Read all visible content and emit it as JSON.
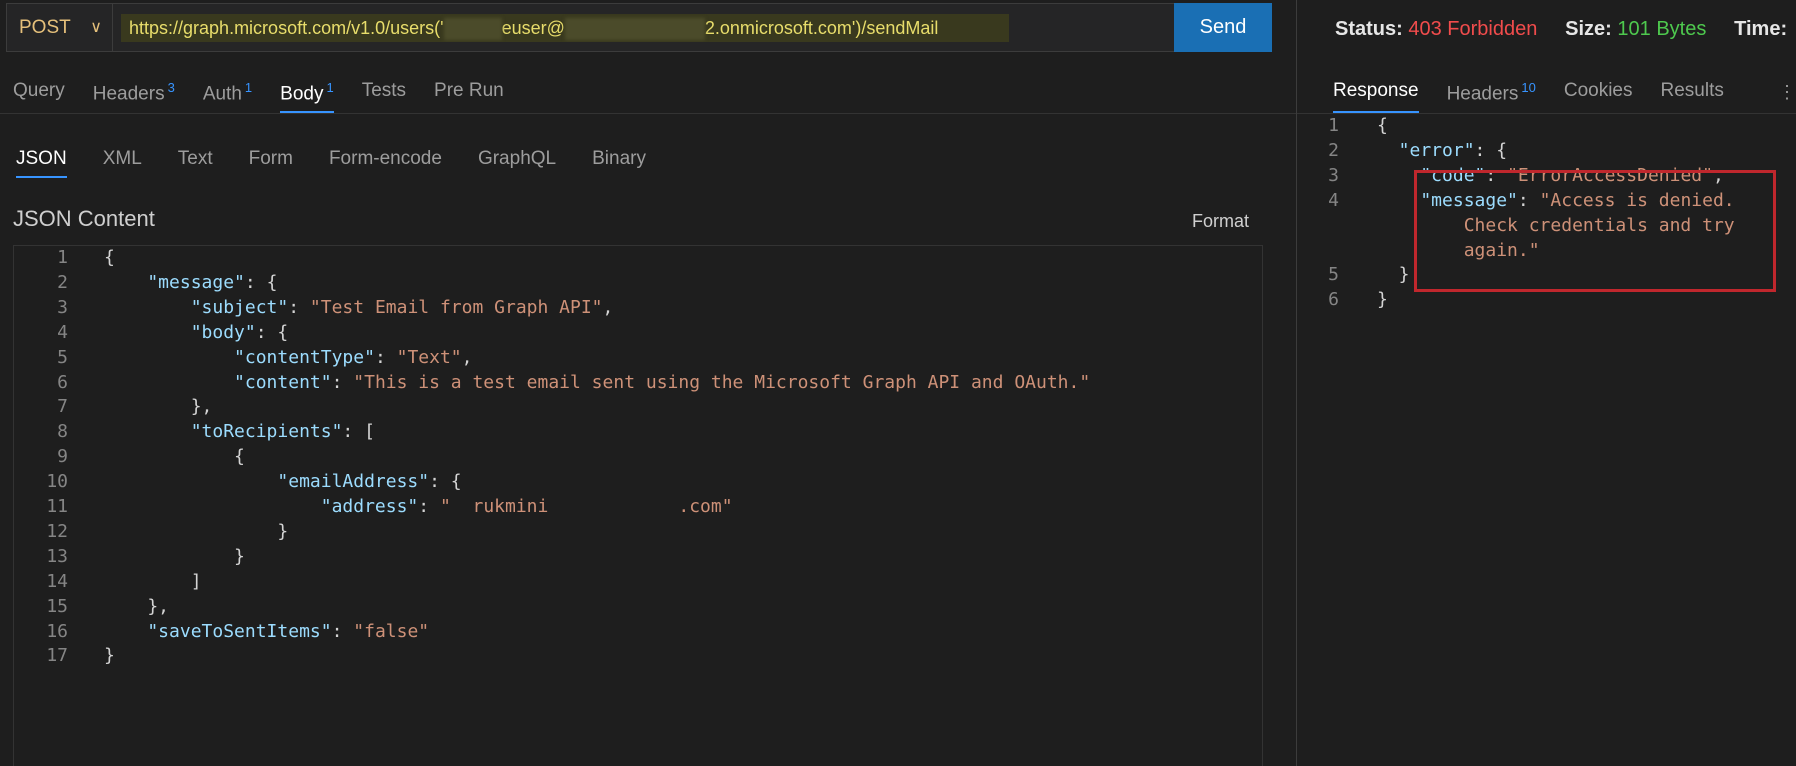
{
  "request": {
    "method": "POST",
    "url_prefix": "https://graph.microsoft.com/v1.0/users('",
    "url_mid": "euser@",
    "url_suffix": "2.onmicrosoft.com')/sendMail",
    "send_label": "Send"
  },
  "request_tabs": [
    {
      "label": "Query",
      "badge": ""
    },
    {
      "label": "Headers",
      "badge": "3"
    },
    {
      "label": "Auth",
      "badge": "1"
    },
    {
      "label": "Body",
      "badge": "1"
    },
    {
      "label": "Tests",
      "badge": ""
    },
    {
      "label": "Pre Run",
      "badge": ""
    }
  ],
  "body_tabs": [
    "JSON",
    "XML",
    "Text",
    "Form",
    "Form-encode",
    "GraphQL",
    "Binary"
  ],
  "editor": {
    "title": "JSON Content",
    "format_label": "Format",
    "lines": [
      [
        [
          "b",
          "{"
        ]
      ],
      [
        [
          "k",
          "    \"message\""
        ],
        [
          "p",
          ": {"
        ]
      ],
      [
        [
          "k",
          "        \"subject\""
        ],
        [
          "p",
          ": "
        ],
        [
          "s",
          "\"Test Email from Graph API\""
        ],
        [
          "p",
          ","
        ]
      ],
      [
        [
          "k",
          "        \"body\""
        ],
        [
          "p",
          ": {"
        ]
      ],
      [
        [
          "k",
          "            \"contentType\""
        ],
        [
          "p",
          ": "
        ],
        [
          "s",
          "\"Text\""
        ],
        [
          "p",
          ","
        ]
      ],
      [
        [
          "k",
          "            \"content\""
        ],
        [
          "p",
          ": "
        ],
        [
          "s",
          "\"This is a test email sent using the Microsoft Graph API and OAuth.\""
        ]
      ],
      [
        [
          "p",
          "        },"
        ]
      ],
      [
        [
          "k",
          "        \"toRecipients\""
        ],
        [
          "p",
          ": ["
        ]
      ],
      [
        [
          "p",
          "            {"
        ]
      ],
      [
        [
          "k",
          "                \"emailAddress\""
        ],
        [
          "p",
          ": {"
        ]
      ],
      [
        [
          "k",
          "                    \"address\""
        ],
        [
          "p",
          ": "
        ],
        [
          "s",
          "\"  rukmini            .com\""
        ]
      ],
      [
        [
          "p",
          "                }"
        ]
      ],
      [
        [
          "p",
          "            }"
        ]
      ],
      [
        [
          "p",
          "        ]"
        ]
      ],
      [
        [
          "p",
          "    },"
        ]
      ],
      [
        [
          "k",
          "    \"saveToSentItems\""
        ],
        [
          "p",
          ": "
        ],
        [
          "s",
          "\"false\""
        ]
      ],
      [
        [
          "b",
          "}"
        ]
      ]
    ]
  },
  "response": {
    "status_label": "Status:",
    "status_value": "403 Forbidden",
    "size_label": "Size:",
    "size_value": "101 Bytes",
    "time_label": "Time:",
    "tabs": [
      {
        "label": "Response",
        "badge": ""
      },
      {
        "label": "Headers",
        "badge": "10"
      },
      {
        "label": "Cookies",
        "badge": ""
      },
      {
        "label": "Results",
        "badge": ""
      }
    ],
    "lines": [
      {
        "n": "1",
        "parts": [
          [
            "b",
            "{"
          ]
        ]
      },
      {
        "n": "2",
        "parts": [
          [
            "k",
            "  \"error\""
          ],
          [
            "p",
            ": {"
          ]
        ]
      },
      {
        "n": "3",
        "parts": [
          [
            "k",
            "    \"code\""
          ],
          [
            "p",
            ": "
          ],
          [
            "s",
            "\"ErrorAccessDenied\""
          ],
          [
            "p",
            ","
          ]
        ]
      },
      {
        "n": "4",
        "parts": [
          [
            "k",
            "    \"message\""
          ],
          [
            "p",
            ": "
          ],
          [
            "s",
            "\"Access is denied."
          ]
        ]
      },
      {
        "n": "",
        "parts": [
          [
            "s",
            "        Check credentials and try"
          ]
        ]
      },
      {
        "n": "",
        "parts": [
          [
            "s",
            "        again.\""
          ]
        ]
      },
      {
        "n": "5",
        "parts": [
          [
            "p",
            "  }"
          ]
        ]
      },
      {
        "n": "6",
        "parts": [
          [
            "b",
            "}"
          ]
        ]
      }
    ]
  },
  "colors": {
    "accent": "#3794ff",
    "send_button": "#1a6fb4",
    "status_error": "#f14c4c",
    "size_ok": "#4ec94e",
    "highlight_box": "#c0272d"
  }
}
